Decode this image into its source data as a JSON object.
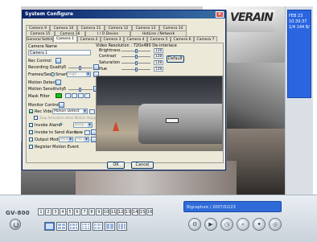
{
  "dialog": {
    "title": "System Configure",
    "tabs_row1": [
      "Camera 9",
      "Camera 10",
      "Camera 11",
      "Camera 12",
      "Camera 13",
      "Camera 14"
    ],
    "tabs_row2": [
      "Camera 15",
      "Camera 16",
      "I / O Device",
      "HotLine / Network"
    ],
    "tabs_row3": [
      "General Setting",
      "Camera 1",
      "Camera 2",
      "Camera 3",
      "Camera 4",
      "Camera 5",
      "Camera 6",
      "Camera 7"
    ],
    "active_tab": "Camera 1"
  },
  "camera": {
    "name_label": "Camera Name",
    "name_value": "Camera 1",
    "rec_control_label": "Rec Control",
    "recording_quality_label": "Recording Quality",
    "recording_quality_value": "5",
    "frames_sec_label": "Frames/Sec",
    "frames_mode": "Smart",
    "frames_select": "High",
    "motion_detect_label": "Motion Detect",
    "motion_sensitivity_label": "Motion Sensitivity",
    "motion_sensitivity_value": "5",
    "mask_filter_label": "Mask Filter",
    "monitor_control_label": "Monitor Control",
    "rec_video_label": "Rec Video",
    "rec_video_select": "Motion Detect",
    "stop_label": "Stop Activation when Motion Stopped",
    "invoke_alarm_label": "Invoke Alarm",
    "invoke_alarm_select": "Beep",
    "invoke_send_label": "Invoke to Send Alarm",
    "invoke_send_value": "Low",
    "output_module_label": "Output Module",
    "output_module_a": "Mod 1",
    "output_module_b": "Pin 1",
    "register_label": "Register Motion Event"
  },
  "video": {
    "resolution_label": "Video Resolution : 720x480 De-interlace",
    "brightness_label": "Brightness",
    "brightness_value": "128",
    "contrast_label": "Contrast",
    "contrast_value": "128",
    "saturation_label": "Saturation",
    "saturation_value": "128",
    "hue_label": "Hue",
    "hue_value": "128",
    "default_label": "Default"
  },
  "buttons": {
    "ok": "OK",
    "cancel": "Cancel"
  },
  "main": {
    "brand": "GV-800",
    "clock_lines": [
      "FEB 23",
      "10:30:37",
      "1/4 144 B/S"
    ],
    "camera_numbers": [
      "1",
      "2",
      "3",
      "4",
      "5",
      "6",
      "7",
      "8",
      "9",
      "10",
      "11",
      "12",
      "13",
      "14",
      "15",
      "16"
    ],
    "status_text": "Bigcapture / 2007/02/23",
    "sign_text": "VERAIN"
  }
}
